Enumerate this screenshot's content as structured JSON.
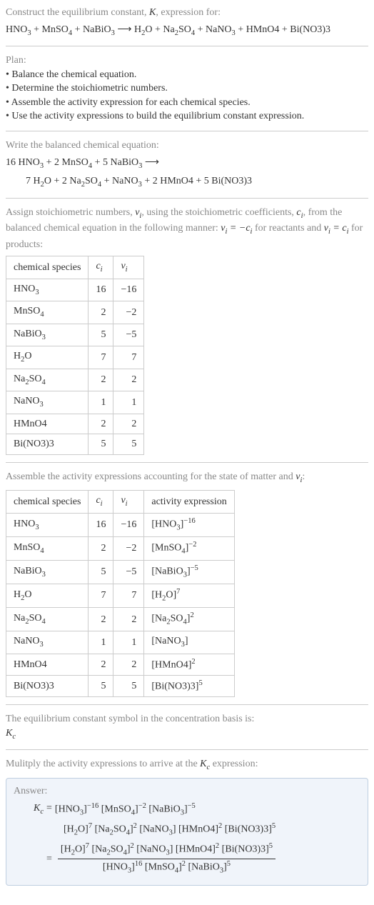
{
  "title": {
    "prefix": "Construct the equilibrium constant, ",
    "K": "K",
    "suffix": ", expression for:"
  },
  "main_equation": "HNO₃ + MnSO₄ + NaBiO₃ ⟶ H₂O + Na₂SO₄ + NaNO₃ + HMnO4 + Bi(NO3)3",
  "plan": {
    "header": "Plan:",
    "items": [
      "• Balance the chemical equation.",
      "• Determine the stoichiometric numbers.",
      "• Assemble the activity expression for each chemical species.",
      "• Use the activity expressions to build the equilibrium constant expression."
    ]
  },
  "balanced": {
    "header": "Write the balanced chemical equation:",
    "line1": "16 HNO₃ + 2 MnSO₄ + 5 NaBiO₃ ⟶",
    "line2": "7 H₂O + 2 Na₂SO₄ + NaNO₃ + 2 HMnO4 + 5 Bi(NO3)3"
  },
  "assign": {
    "text_parts": [
      "Assign stoichiometric numbers, ",
      "νᵢ",
      ", using the stoichiometric coefficients, ",
      "cᵢ",
      ", from the balanced chemical equation in the following manner: ",
      "νᵢ = −cᵢ",
      " for reactants and ",
      "νᵢ = cᵢ",
      " for products:"
    ]
  },
  "table1": {
    "headers": [
      "chemical species",
      "cᵢ",
      "νᵢ"
    ],
    "rows": [
      [
        "HNO₃",
        "16",
        "−16"
      ],
      [
        "MnSO₄",
        "2",
        "−2"
      ],
      [
        "NaBiO₃",
        "5",
        "−5"
      ],
      [
        "H₂O",
        "7",
        "7"
      ],
      [
        "Na₂SO₄",
        "2",
        "2"
      ],
      [
        "NaNO₃",
        "1",
        "1"
      ],
      [
        "HMnO4",
        "2",
        "2"
      ],
      [
        "Bi(NO3)3",
        "5",
        "5"
      ]
    ]
  },
  "activity_header": "Assemble the activity expressions accounting for the state of matter and νᵢ:",
  "table2": {
    "headers": [
      "chemical species",
      "cᵢ",
      "νᵢ",
      "activity expression"
    ],
    "rows": [
      {
        "sp": "HNO₃",
        "c": "16",
        "v": "−16",
        "base": "[HNO₃]",
        "exp": "−16"
      },
      {
        "sp": "MnSO₄",
        "c": "2",
        "v": "−2",
        "base": "[MnSO₄]",
        "exp": "−2"
      },
      {
        "sp": "NaBiO₃",
        "c": "5",
        "v": "−5",
        "base": "[NaBiO₃]",
        "exp": "−5"
      },
      {
        "sp": "H₂O",
        "c": "7",
        "v": "7",
        "base": "[H₂O]",
        "exp": "7"
      },
      {
        "sp": "Na₂SO₄",
        "c": "2",
        "v": "2",
        "base": "[Na₂SO₄]",
        "exp": "2"
      },
      {
        "sp": "NaNO₃",
        "c": "1",
        "v": "1",
        "base": "[NaNO₃]",
        "exp": ""
      },
      {
        "sp": "HMnO4",
        "c": "2",
        "v": "2",
        "base": "[HMnO4]",
        "exp": "2"
      },
      {
        "sp": "Bi(NO3)3",
        "c": "5",
        "v": "5",
        "base": "[Bi(NO3)3]",
        "exp": "5"
      }
    ]
  },
  "basis": {
    "line1": "The equilibrium constant symbol in the concentration basis is:",
    "symbol": "K_c"
  },
  "multiply": "Mulitply the activity expressions to arrive at the K_c expression:",
  "answer": {
    "label": "Answer:",
    "kc": "K_c",
    "eq": "=",
    "line1": "[HNO₃]⁻¹⁶ [MnSO₄]⁻² [NaBiO₃]⁻⁵",
    "line2": "[H₂O]⁷ [Na₂SO₄]² [NaNO₃] [HMnO4]² [Bi(NO3)3]⁵",
    "frac_num": "[H₂O]⁷ [Na₂SO₄]² [NaNO₃] [HMnO4]² [Bi(NO3)3]⁵",
    "frac_den": "[HNO₃]¹⁶ [MnSO₄]² [NaBiO₃]⁵"
  }
}
